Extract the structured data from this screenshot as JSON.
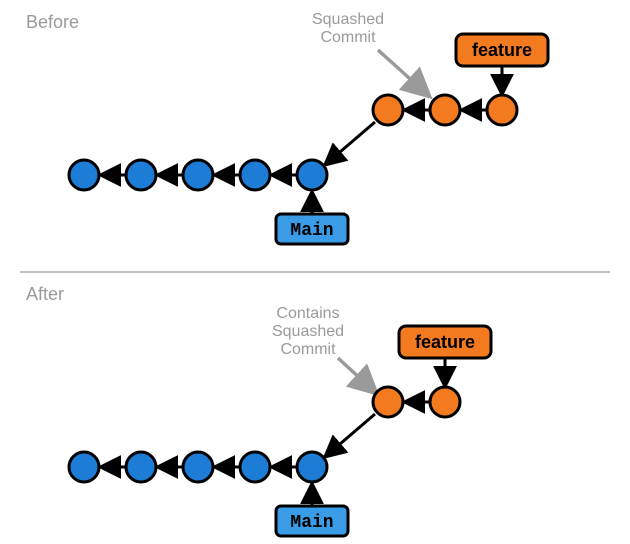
{
  "labels": {
    "before": "Before",
    "after": "After"
  },
  "annotations": {
    "before_line1": "Squashed",
    "before_line2": "Commit",
    "after_line1": "Contains",
    "after_line2": "Squashed",
    "after_line3": "Commit"
  },
  "tags": {
    "feature": "feature",
    "main": "Main"
  },
  "colors": {
    "blue_fill": "#1C7CD6",
    "blue_tag": "#3A9BE6",
    "orange": "#F47A20",
    "outline": "#000000",
    "grey": "#9a9a9a"
  },
  "diagram": {
    "description": "Git squash-merge diagram showing feature branch merged into main with a squashed commit before and after states.",
    "before": {
      "main_commits": 5,
      "feature_commits": 3,
      "squashed_commit_index_on_feature": 1,
      "main_branch_name": "Main",
      "feature_branch_name": "feature"
    },
    "after": {
      "main_commits": 5,
      "feature_commits": 2,
      "contains_squashed_commit_index_on_feature": 0,
      "main_branch_name": "Main",
      "feature_branch_name": "feature"
    }
  }
}
